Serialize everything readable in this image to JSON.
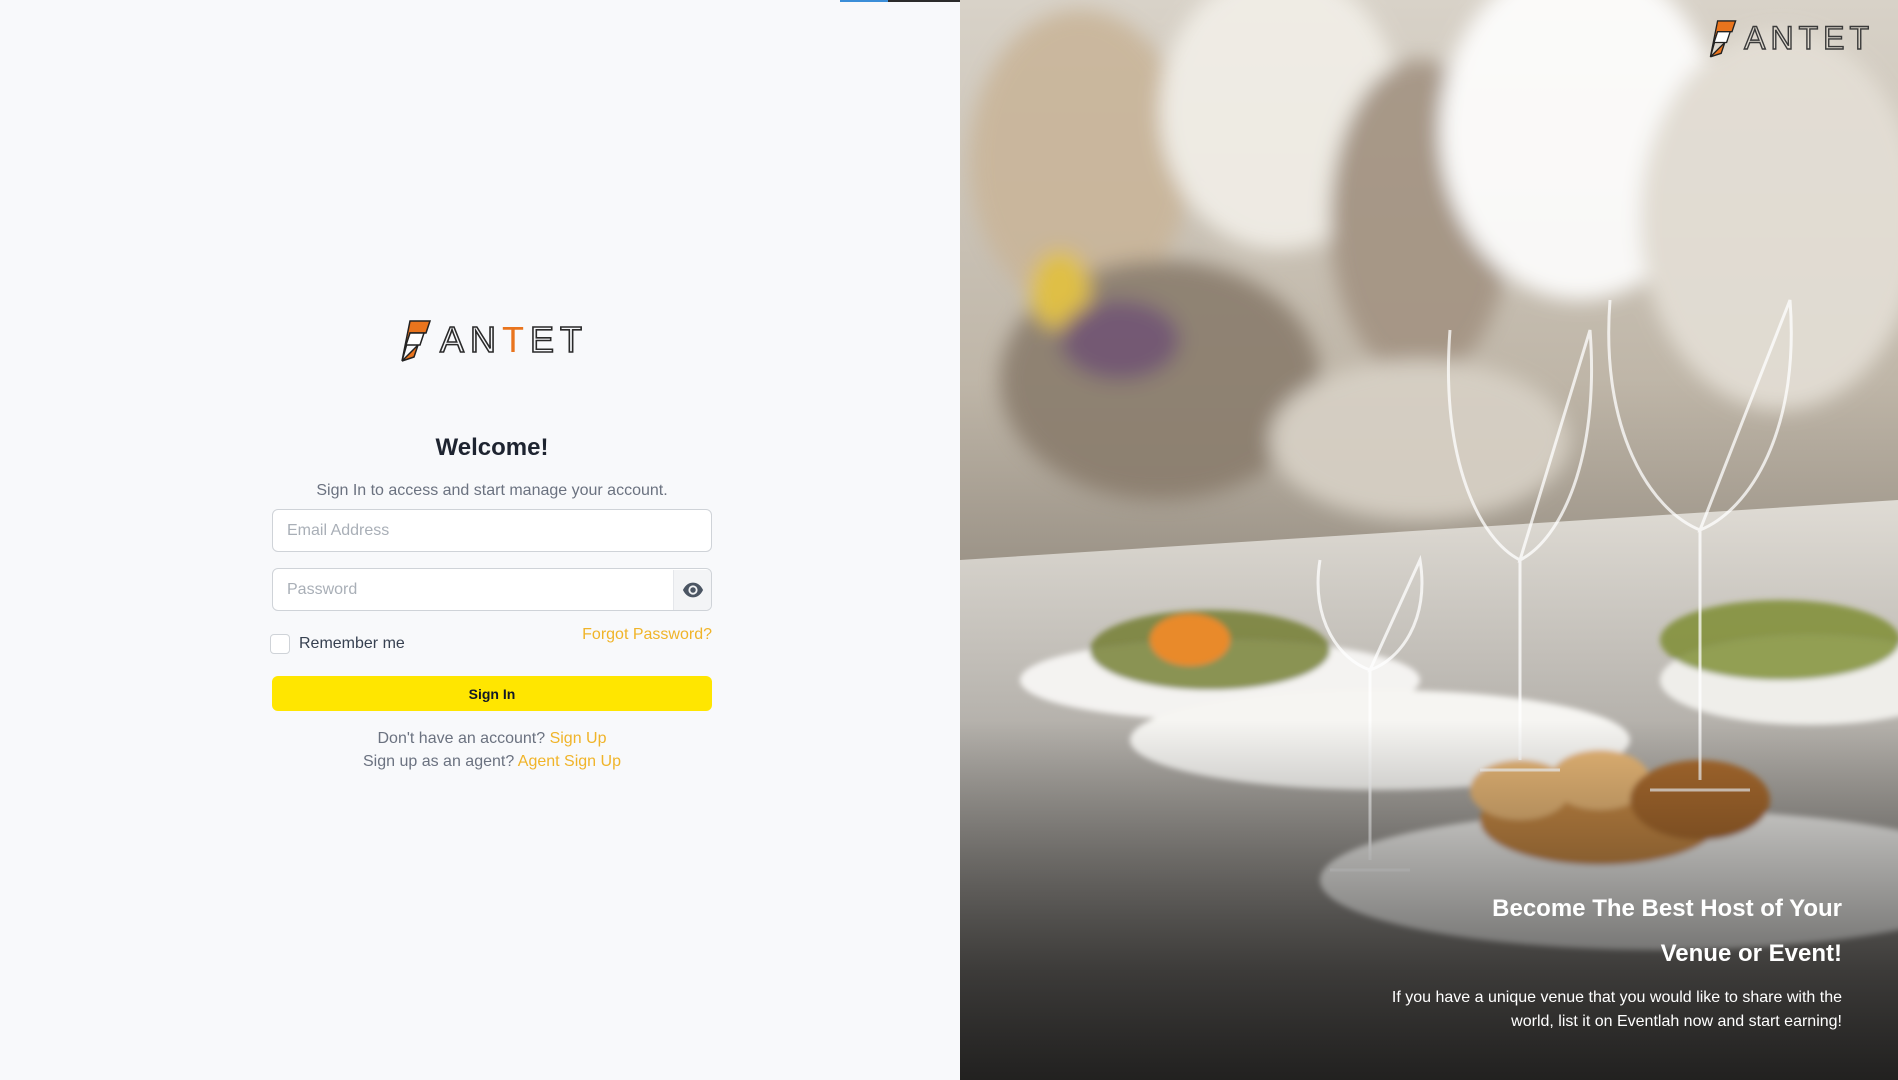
{
  "brand": {
    "name_prefix": "AN",
    "name_accent": "T",
    "name_suffix": "ET",
    "accent_color": "#e9741d"
  },
  "login": {
    "title": "Welcome!",
    "subtitle": "Sign In to access and start manage your account.",
    "email_placeholder": "Email Address",
    "password_placeholder": "Password",
    "remember_label": "Remember me",
    "forgot_link": "Forgot Password?",
    "signin_label": "Sign In",
    "no_account_text": "Don't have an account?",
    "signup_link": "Sign Up",
    "agent_text": "Sign up as an agent?",
    "agent_signup_link": "Agent Sign Up",
    "button_color": "#ffe600",
    "link_color": "#f0b429"
  },
  "promo": {
    "title_line1": "Become The Best Host of Your",
    "title_line2": "Venue or Event!",
    "text_line1": "If you have a unique venue that you would like to share with the",
    "text_line2": "world, list it on Eventlah now and start earning!"
  },
  "icons": {
    "logo_mark": "fantet-logo-icon",
    "password_toggle": "eye-icon"
  }
}
